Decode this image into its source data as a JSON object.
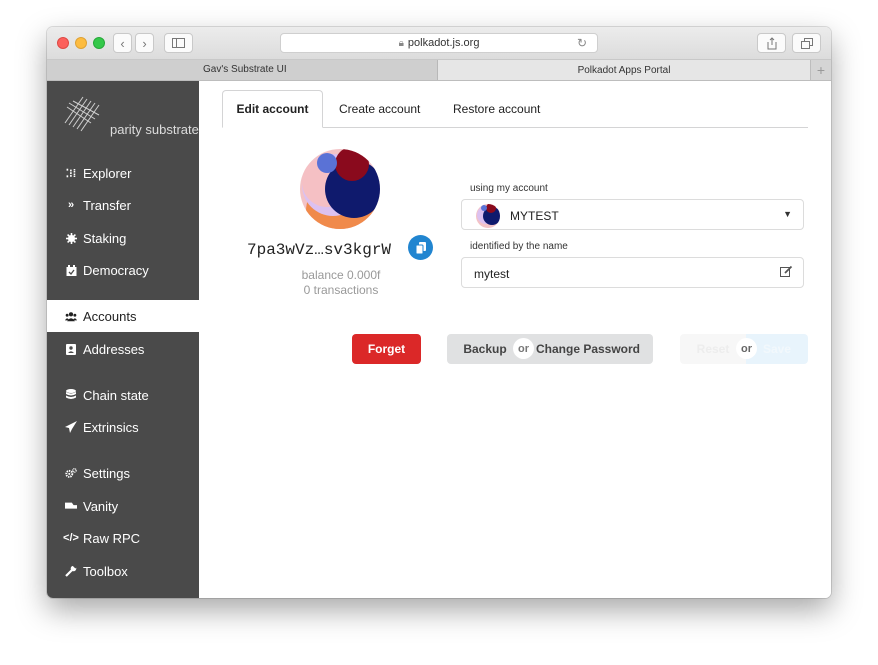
{
  "browser": {
    "url": "polkadot.js.org",
    "tabs": [
      "Gav's Substrate UI",
      "Polkadot Apps Portal"
    ],
    "new_tab_label": "+"
  },
  "sidebar": {
    "logo_text": "parity substrate",
    "items": [
      {
        "label": "Explorer",
        "icon": "explorer-icon"
      },
      {
        "label": "Transfer",
        "icon": "transfer-icon"
      },
      {
        "label": "Staking",
        "icon": "staking-icon"
      },
      {
        "label": "Democracy",
        "icon": "democracy-icon"
      },
      {
        "label": "Accounts",
        "icon": "accounts-icon"
      },
      {
        "label": "Addresses",
        "icon": "addresses-icon"
      },
      {
        "label": "Chain state",
        "icon": "database-icon"
      },
      {
        "label": "Extrinsics",
        "icon": "send-icon"
      },
      {
        "label": "Settings",
        "icon": "settings-icon"
      },
      {
        "label": "Vanity",
        "icon": "vanity-icon"
      },
      {
        "label": "Raw RPC",
        "icon": "code-icon"
      },
      {
        "label": "Toolbox",
        "icon": "wrench-icon"
      }
    ],
    "active": "Accounts"
  },
  "main": {
    "tabs": [
      "Edit account",
      "Create account",
      "Restore account"
    ],
    "active_tab": "Edit account",
    "address": "7pa3wVz…sv3kgrW",
    "balance": "balance 0.000f",
    "transactions": "0 transactions",
    "account_select": {
      "label": "using my account",
      "value": "MYTEST"
    },
    "name_field": {
      "label": "identified by the name",
      "value": "mytest"
    },
    "buttons": {
      "forget": "Forget",
      "backup": "Backup",
      "or": "or",
      "change_password": "Change Password",
      "reset": "Reset",
      "save": "Save"
    }
  },
  "colors": {
    "sidebar_bg": "#4a4a4a",
    "danger": "#db2828",
    "primary": "#2185d0",
    "button_grey": "#e0e1e2"
  }
}
